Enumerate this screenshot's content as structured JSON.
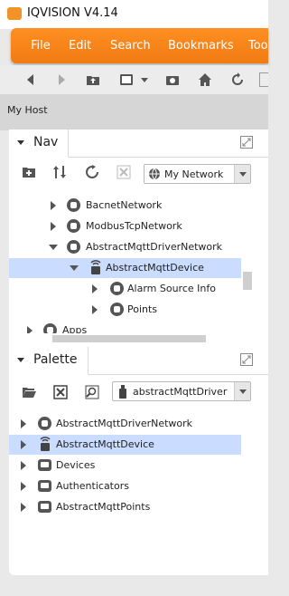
{
  "app": {
    "title": "IQVISION V4.14",
    "logo": "iq-logo-icon",
    "accent": "#f58320"
  },
  "menu": [
    "File",
    "Edit",
    "Search",
    "Bookmarks",
    "Too"
  ],
  "toolbar": [
    "back-icon",
    "forward-icon",
    "up-folder-icon",
    "side-bar-icon",
    "dropdown-icon",
    "camera-icon",
    "home-icon",
    "refresh-icon"
  ],
  "host": {
    "label": "My Host"
  },
  "nav": {
    "title": "Nav",
    "combo_value": "My Network",
    "tree": [
      {
        "label": "BacnetNetwork",
        "expanded": false
      },
      {
        "label": "ModbusTcpNetwork",
        "expanded": false
      },
      {
        "label": "AbstractMqttDriverNetwork",
        "expanded": true
      },
      {
        "label": "AbstractMqttDevice",
        "expanded": true,
        "selected": true
      },
      {
        "label": "Alarm Source Info",
        "expanded": false
      },
      {
        "label": "Points",
        "expanded": false
      },
      {
        "label": "Apps",
        "expanded": false
      }
    ]
  },
  "palette": {
    "title": "Palette",
    "combo_value": "abstractMqttDriver",
    "items": [
      {
        "label": "AbstractMqttDriverNetwork"
      },
      {
        "label": "AbstractMqttDevice",
        "selected": true
      },
      {
        "label": "Devices"
      },
      {
        "label": "Authenticators"
      },
      {
        "label": "AbstractMqttPoints"
      }
    ]
  }
}
